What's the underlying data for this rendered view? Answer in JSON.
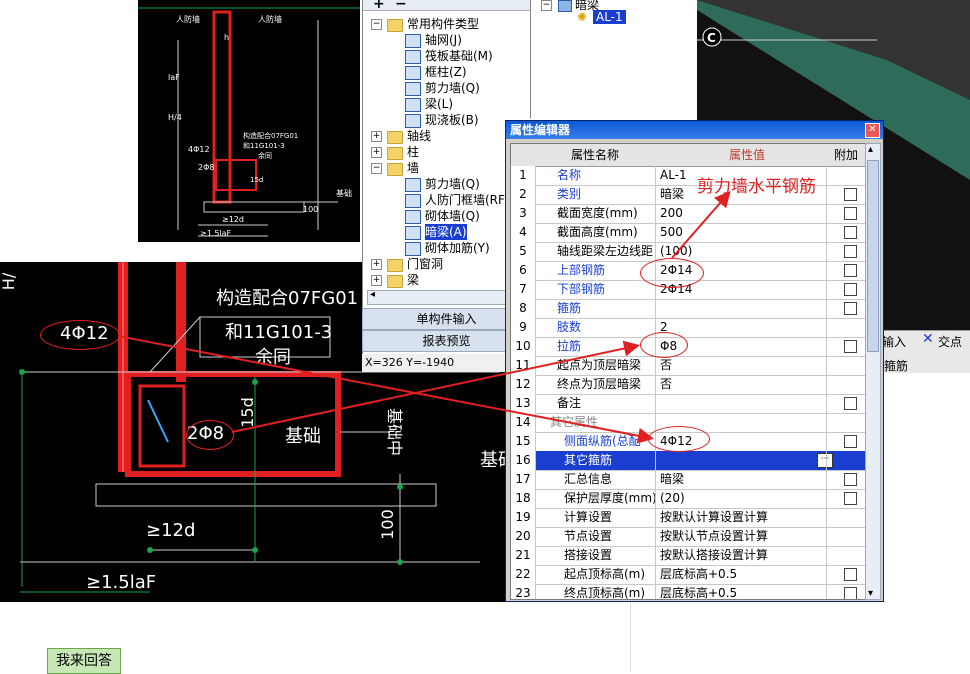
{
  "tree": {
    "items": [
      {
        "label": "常用构件类型",
        "type": "folder-open"
      },
      {
        "label": "轴网(J)",
        "type": "item"
      },
      {
        "label": "筏板基础(M)",
        "type": "item"
      },
      {
        "label": "框柱(Z)",
        "type": "item"
      },
      {
        "label": "剪力墙(Q)",
        "type": "item"
      },
      {
        "label": "梁(L)",
        "type": "item"
      },
      {
        "label": "现浇板(B)",
        "type": "item"
      },
      {
        "label": "轴线",
        "type": "folder"
      },
      {
        "label": "柱",
        "type": "folder"
      },
      {
        "label": "墙",
        "type": "folder-open"
      },
      {
        "label": "剪力墙(Q)",
        "type": "item"
      },
      {
        "label": "人防门框墙(RF",
        "type": "item"
      },
      {
        "label": "砌体墙(Q)",
        "type": "item"
      },
      {
        "label": "暗梁(A)",
        "type": "item-selected"
      },
      {
        "label": "砌体加筋(Y)",
        "type": "item"
      },
      {
        "label": "门窗洞",
        "type": "folder"
      },
      {
        "label": "梁",
        "type": "folder"
      }
    ],
    "btn_single": "单构件输入",
    "btn_report": "报表预览",
    "coords": "X=326 Y=-1940"
  },
  "layers": {
    "parent": "暗梁",
    "child": "AL-1"
  },
  "right_toolbar": {
    "input_label": "输入",
    "intersect_label": "交点",
    "status_label": "箍筋"
  },
  "editor": {
    "title": "属性编辑器",
    "col_name": "属性名称",
    "col_value": "属性值",
    "col_add": "附加",
    "rows": [
      {
        "n": "1",
        "name": "名称",
        "value": "AL-1",
        "blue": true,
        "check": false
      },
      {
        "n": "2",
        "name": "类别",
        "value": "暗梁",
        "blue": true,
        "check": true
      },
      {
        "n": "3",
        "name": "截面宽度(mm)",
        "value": "200",
        "blue": false,
        "check": true
      },
      {
        "n": "4",
        "name": "截面高度(mm)",
        "value": "500",
        "blue": false,
        "check": true
      },
      {
        "n": "5",
        "name": "轴线距梁左边线距",
        "value": "(100)",
        "blue": false,
        "check": true
      },
      {
        "n": "6",
        "name": "上部钢筋",
        "value": "2Φ14",
        "blue": true,
        "check": true
      },
      {
        "n": "7",
        "name": "下部钢筋",
        "value": "2Φ14",
        "blue": true,
        "check": true
      },
      {
        "n": "8",
        "name": "箍筋",
        "value": "",
        "blue": true,
        "check": true
      },
      {
        "n": "9",
        "name": "肢数",
        "value": "2",
        "blue": true,
        "check": false
      },
      {
        "n": "10",
        "name": "拉筋",
        "value": "Φ8",
        "blue": true,
        "check": true
      },
      {
        "n": "11",
        "name": "起点为顶层暗梁",
        "value": "否",
        "blue": false,
        "check": false
      },
      {
        "n": "12",
        "name": "终点为顶层暗梁",
        "value": "否",
        "blue": false,
        "check": false
      },
      {
        "n": "13",
        "name": "备注",
        "value": "",
        "blue": false,
        "check": true
      },
      {
        "n": "14",
        "name": "其它属性",
        "value": "",
        "blue": false,
        "check": false
      },
      {
        "n": "15",
        "name": "侧面纵筋(总配",
        "value": "4Φ12",
        "blue": true,
        "check": true
      },
      {
        "n": "16",
        "name": "其它箍筋",
        "value": "",
        "blue": false,
        "check": false
      },
      {
        "n": "17",
        "name": "汇总信息",
        "value": "暗梁",
        "blue": false,
        "check": true
      },
      {
        "n": "18",
        "name": "保护层厚度(mm)",
        "value": "(20)",
        "blue": false,
        "check": true
      },
      {
        "n": "19",
        "name": "计算设置",
        "value": "按默认计算设置计算",
        "blue": false,
        "check": false
      },
      {
        "n": "20",
        "name": "节点设置",
        "value": "按默认节点设置计算",
        "blue": false,
        "check": false
      },
      {
        "n": "21",
        "name": "搭接设置",
        "value": "按默认搭接设置计算",
        "blue": false,
        "check": false
      },
      {
        "n": "22",
        "name": "起点顶标高(m)",
        "value": "层底标高+0.5",
        "blue": false,
        "check": true
      },
      {
        "n": "23",
        "name": "终点顶标高(m)",
        "value": "层底标高+0.5",
        "blue": false,
        "check": true
      }
    ]
  },
  "annotation": {
    "label": "剪力墙水平钢筋"
  },
  "cad_top": {
    "labels": [
      "人防墙",
      "人防墙",
      "h",
      "构造配合07FG01",
      "和11G101-3",
      "余同",
      "4Φ12",
      "2Φ8",
      "15d",
      "≥12d",
      "≥1.5laF",
      "基础",
      "H/4",
      "100",
      "laF",
      "基础"
    ]
  },
  "cad_main": {
    "label_note1": "构造配合07FG01",
    "label_note2": "和11G101-3",
    "label_note3": "余同",
    "label_4phi12": "4Φ12",
    "label_2phi8": "2Φ8",
    "label_15d": "15d",
    "label_jichu": "基础",
    "label_jichu2": "基础",
    "label_12d": "≥12d",
    "label_15laf": "≥1.5laF",
    "label_100": "100",
    "label_h": "H/",
    "label_jichu_vert": "基础中"
  },
  "answer_button": "我来回答",
  "colors": {
    "accent_red": "#e02020",
    "selection": "#1a3fd0",
    "cad_bg": "#000000"
  }
}
